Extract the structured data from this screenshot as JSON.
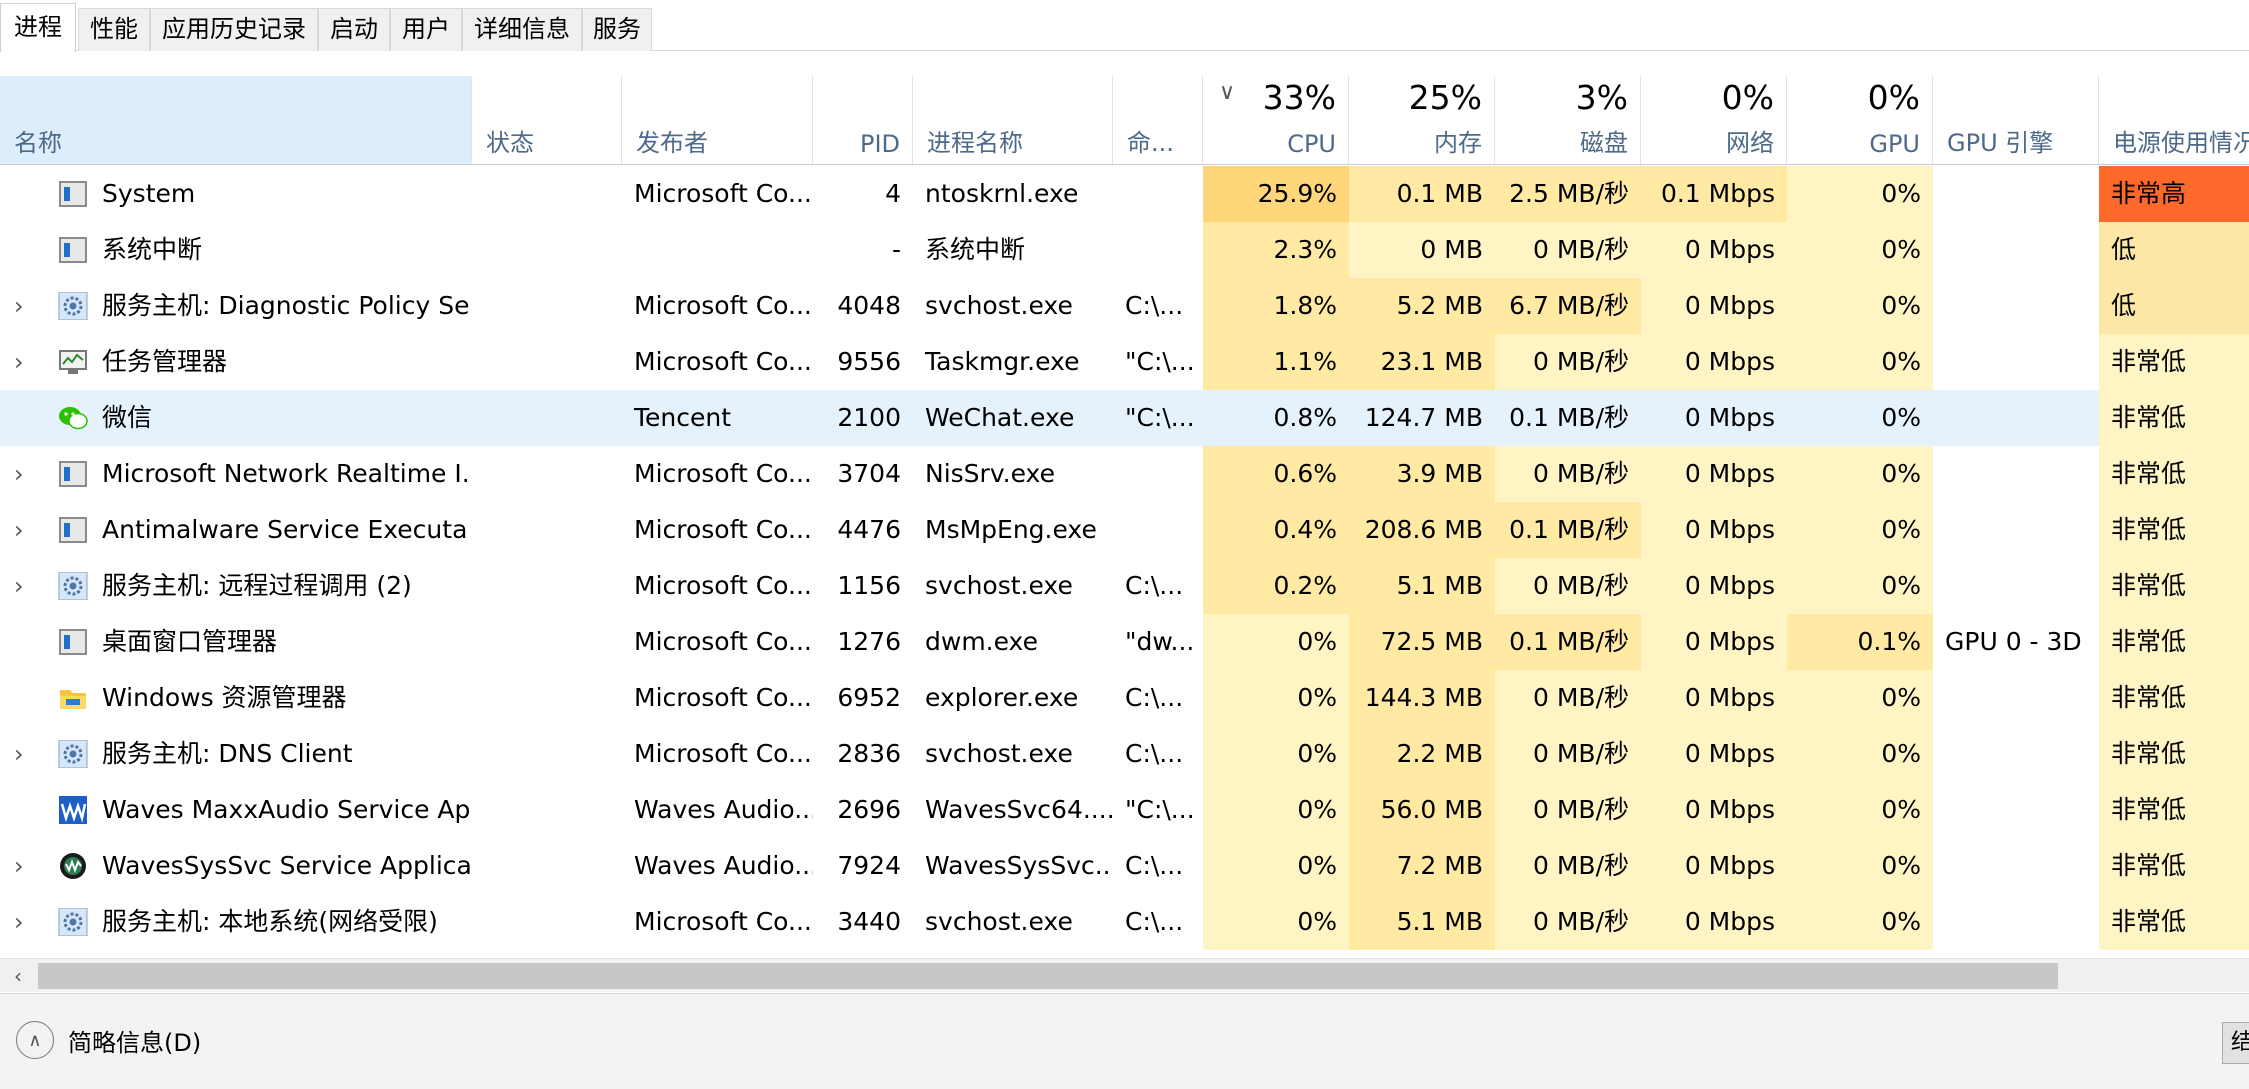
{
  "tabs": [
    {
      "label": "进程",
      "active": true
    },
    {
      "label": "性能"
    },
    {
      "label": "应用历史记录"
    },
    {
      "label": "启动"
    },
    {
      "label": "用户"
    },
    {
      "label": "详细信息"
    },
    {
      "label": "服务"
    }
  ],
  "header": {
    "name": "名称",
    "status": "状态",
    "publisher": "发布者",
    "pid": "PID",
    "process_name": "进程名称",
    "cmdline": "命...",
    "cpu": {
      "pct": "33%",
      "label": "CPU"
    },
    "memory": {
      "pct": "25%",
      "label": "内存"
    },
    "disk": {
      "pct": "3%",
      "label": "磁盘"
    },
    "network": {
      "pct": "0%",
      "label": "网络"
    },
    "gpu": {
      "pct": "0%",
      "label": "GPU"
    },
    "gpu_engine": "GPU 引擎",
    "power": "电源使用情况"
  },
  "rows": [
    {
      "icon": "window-icon",
      "expandable": false,
      "name": "System",
      "publisher": "Microsoft Co...",
      "pid": "4",
      "proc": "ntoskrnl.exe",
      "cmd": "",
      "cpu": "25.9%",
      "mem": "0.1 MB",
      "disk": "2.5 MB/秒",
      "net": "0.1 Mbps",
      "gpu": "0%",
      "gpu_engine": "",
      "power": "非常高",
      "power_level": "very-high"
    },
    {
      "icon": "window-icon",
      "expandable": false,
      "name": "系统中断",
      "publisher": "",
      "pid": "-",
      "proc": "系统中断",
      "cmd": "",
      "cpu": "2.3%",
      "mem": "0 MB",
      "disk": "0 MB/秒",
      "net": "0 Mbps",
      "gpu": "0%",
      "gpu_engine": "",
      "power": "低",
      "power_level": "low"
    },
    {
      "icon": "gear-icon",
      "expandable": true,
      "name": "服务主机: Diagnostic Policy Se...",
      "publisher": "Microsoft Co...",
      "pid": "4048",
      "proc": "svchost.exe",
      "cmd": "C:\\...",
      "cpu": "1.8%",
      "mem": "5.2 MB",
      "disk": "6.7 MB/秒",
      "net": "0 Mbps",
      "gpu": "0%",
      "gpu_engine": "",
      "power": "低",
      "power_level": "low"
    },
    {
      "icon": "taskmgr-icon",
      "expandable": true,
      "name": "任务管理器",
      "publisher": "Microsoft Co...",
      "pid": "9556",
      "proc": "Taskmgr.exe",
      "cmd": "\"C:\\...",
      "cpu": "1.1%",
      "mem": "23.1 MB",
      "disk": "0 MB/秒",
      "net": "0 Mbps",
      "gpu": "0%",
      "gpu_engine": "",
      "power": "非常低",
      "power_level": "very-low"
    },
    {
      "icon": "wechat-icon",
      "expandable": false,
      "selected": true,
      "name": "微信",
      "publisher": "Tencent",
      "pid": "2100",
      "proc": "WeChat.exe",
      "cmd": "\"C:\\...",
      "cpu": "0.8%",
      "mem": "124.7 MB",
      "disk": "0.1 MB/秒",
      "net": "0 Mbps",
      "gpu": "0%",
      "gpu_engine": "",
      "power": "非常低",
      "power_level": "very-low"
    },
    {
      "icon": "window-icon",
      "expandable": true,
      "name": "Microsoft Network Realtime I...",
      "publisher": "Microsoft Co...",
      "pid": "3704",
      "proc": "NisSrv.exe",
      "cmd": "",
      "cpu": "0.6%",
      "mem": "3.9 MB",
      "disk": "0 MB/秒",
      "net": "0 Mbps",
      "gpu": "0%",
      "gpu_engine": "",
      "power": "非常低",
      "power_level": "very-low"
    },
    {
      "icon": "window-icon",
      "expandable": true,
      "name": "Antimalware Service Executa...",
      "publisher": "Microsoft Co...",
      "pid": "4476",
      "proc": "MsMpEng.exe",
      "cmd": "",
      "cpu": "0.4%",
      "mem": "208.6 MB",
      "disk": "0.1 MB/秒",
      "net": "0 Mbps",
      "gpu": "0%",
      "gpu_engine": "",
      "power": "非常低",
      "power_level": "very-low"
    },
    {
      "icon": "gear-icon",
      "expandable": true,
      "name": "服务主机: 远程过程调用 (2)",
      "publisher": "Microsoft Co...",
      "pid": "1156",
      "proc": "svchost.exe",
      "cmd": "C:\\...",
      "cpu": "0.2%",
      "mem": "5.1 MB",
      "disk": "0 MB/秒",
      "net": "0 Mbps",
      "gpu": "0%",
      "gpu_engine": "",
      "power": "非常低",
      "power_level": "very-low"
    },
    {
      "icon": "window-icon",
      "expandable": false,
      "name": "桌面窗口管理器",
      "publisher": "Microsoft Co...",
      "pid": "1276",
      "proc": "dwm.exe",
      "cmd": "\"dw...",
      "cpu": "0%",
      "mem": "72.5 MB",
      "disk": "0.1 MB/秒",
      "net": "0 Mbps",
      "gpu": "0.1%",
      "gpu_engine": "GPU 0 - 3D",
      "power": "非常低",
      "power_level": "very-low"
    },
    {
      "icon": "folder-icon",
      "expandable": false,
      "name": "Windows 资源管理器",
      "publisher": "Microsoft Co...",
      "pid": "6952",
      "proc": "explorer.exe",
      "cmd": "C:\\...",
      "cpu": "0%",
      "mem": "144.3 MB",
      "disk": "0 MB/秒",
      "net": "0 Mbps",
      "gpu": "0%",
      "gpu_engine": "",
      "power": "非常低",
      "power_level": "very-low"
    },
    {
      "icon": "gear-icon",
      "expandable": true,
      "name": "服务主机: DNS Client",
      "publisher": "Microsoft Co...",
      "pid": "2836",
      "proc": "svchost.exe",
      "cmd": "C:\\...",
      "cpu": "0%",
      "mem": "2.2 MB",
      "disk": "0 MB/秒",
      "net": "0 Mbps",
      "gpu": "0%",
      "gpu_engine": "",
      "power": "非常低",
      "power_level": "very-low"
    },
    {
      "icon": "waves-icon",
      "expandable": false,
      "name": "Waves MaxxAudio Service Ap...",
      "publisher": "Waves Audio...",
      "pid": "2696",
      "proc": "WavesSvc64....",
      "cmd": "\"C:\\...",
      "cpu": "0%",
      "mem": "56.0 MB",
      "disk": "0 MB/秒",
      "net": "0 Mbps",
      "gpu": "0%",
      "gpu_engine": "",
      "power": "非常低",
      "power_level": "very-low"
    },
    {
      "icon": "waves-sys-icon",
      "expandable": true,
      "name": "WavesSysSvc Service Applica...",
      "publisher": "Waves Audio...",
      "pid": "7924",
      "proc": "WavesSysSvc...",
      "cmd": "C:\\...",
      "cpu": "0%",
      "mem": "7.2 MB",
      "disk": "0 MB/秒",
      "net": "0 Mbps",
      "gpu": "0%",
      "gpu_engine": "",
      "power": "非常低",
      "power_level": "very-low"
    },
    {
      "icon": "gear-icon",
      "expandable": true,
      "name": "服务主机: 本地系统(网络受限)",
      "publisher": "Microsoft Co...",
      "pid": "3440",
      "proc": "svchost.exe",
      "cmd": "C:\\...",
      "cpu": "0%",
      "mem": "5.1 MB",
      "disk": "0 MB/秒",
      "net": "0 Mbps",
      "gpu": "0%",
      "gpu_engine": "",
      "power": "非常低",
      "power_level": "very-low"
    }
  ],
  "footer": {
    "fewer_details": "简略信息(D)",
    "end_task": "结"
  },
  "colors": {
    "selected_row": "#e5f1fb",
    "heat_light": "#fff4c4",
    "heat_mid": "#ffe9a3",
    "heat_high": "#ffd67a",
    "power_very_high": "#ff6a2b"
  }
}
